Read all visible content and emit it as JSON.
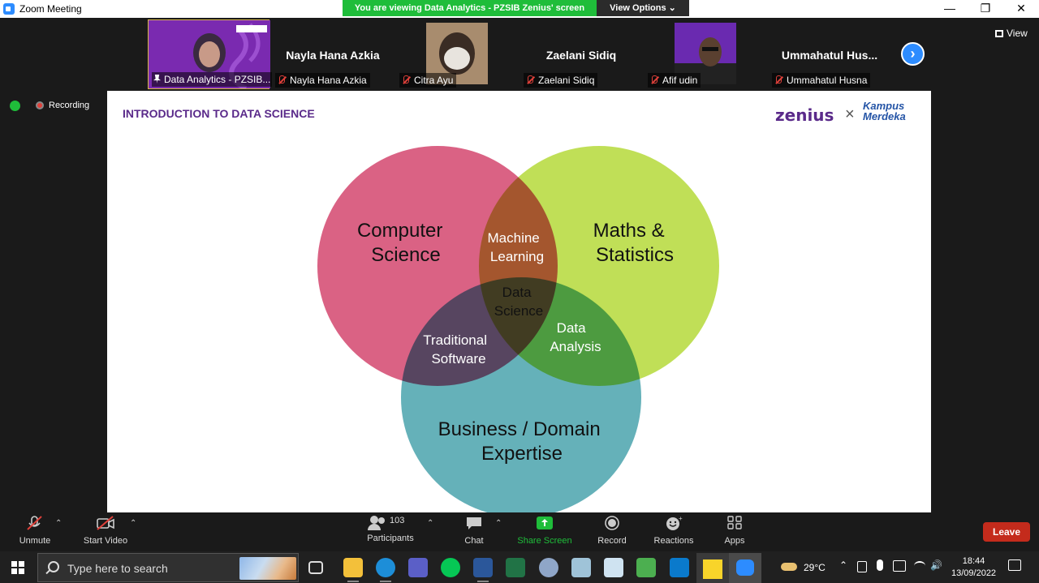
{
  "window": {
    "title": "Zoom Meeting",
    "controls": [
      "—",
      "❐",
      "✕"
    ]
  },
  "share_banner": {
    "text": "You are viewing Data Analytics - PZSIB Zenius' screen",
    "view_options": "View Options ⌄"
  },
  "participants_strip": {
    "tiles": [
      {
        "label": "Data Analytics - PZSIB...",
        "pinned": true
      },
      {
        "big_name": "Nayla Hana Azkia",
        "label": "Nayla Hana Azkia"
      },
      {
        "label": "Citra Ayu"
      },
      {
        "big_name": "Zaelani Sidiq",
        "label": "Zaelani Sidiq"
      },
      {
        "label": "Afif udin"
      },
      {
        "big_name": "Ummahatul  Hus...",
        "label": "Ummahatul Husna"
      }
    ],
    "next": "›",
    "view_label": "View"
  },
  "status": {
    "recording": "Recording"
  },
  "slide": {
    "title": "INTRODUCTION TO DATA SCIENCE",
    "logo_zenius": "zenius",
    "logo_x": "×",
    "logo_kampus": [
      "Kampus",
      "Merdeka"
    ],
    "venn": {
      "circles": [
        {
          "name": "Computer Science",
          "color": "#d4476f"
        },
        {
          "name": "Maths & Statistics",
          "color": "#b5d93a"
        },
        {
          "name": "Business / Domain Expertise",
          "color": "#4aa3ad"
        }
      ],
      "labels": {
        "cs": [
          "Computer",
          "Science"
        ],
        "ms": [
          "Maths &",
          "Statistics"
        ],
        "bd": [
          "Business / Domain",
          "Expertise"
        ],
        "ml": [
          "Machine",
          "Learning"
        ],
        "ds": [
          "Data",
          "Science"
        ],
        "ts": [
          "Traditional",
          "Software"
        ],
        "da": [
          "Data",
          "Analysis"
        ]
      }
    }
  },
  "toolbar": {
    "unmute": "Unmute",
    "start_video": "Start Video",
    "participants": "Participants",
    "participants_count": "103",
    "chat": "Chat",
    "share_screen": "Share Screen",
    "record": "Record",
    "reactions": "Reactions",
    "apps": "Apps",
    "leave": "Leave"
  },
  "taskbar": {
    "search_placeholder": "Type here to search",
    "weather": "29°C",
    "time": "18:44",
    "date": "13/09/2022"
  }
}
